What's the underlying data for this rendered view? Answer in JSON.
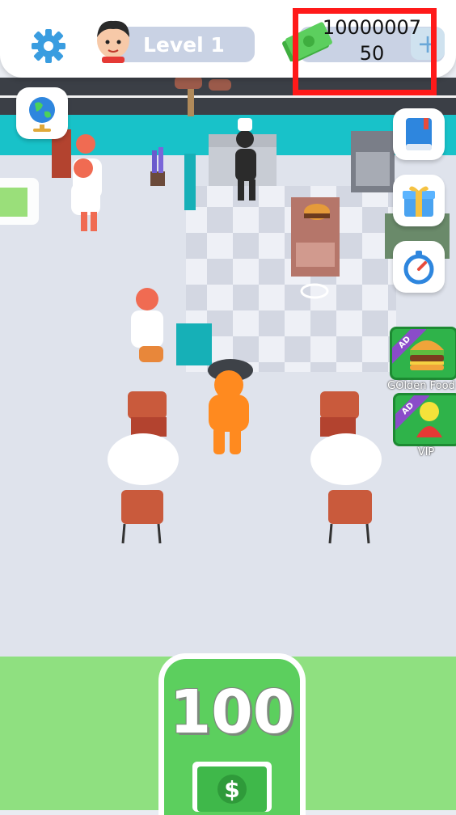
{
  "hud": {
    "level_label": "Level 1",
    "money_line1": "10000007",
    "money_line2": "50",
    "plus_symbol": "+"
  },
  "side_buttons": {
    "world": "globe-icon",
    "recipes": "book-icon",
    "gift": "gift-icon",
    "timer": "stopwatch-icon"
  },
  "ads": {
    "golden_food": {
      "badge": "AD",
      "caption": "GOlden Food"
    },
    "vip": {
      "badge": "AD",
      "caption": "VIP"
    }
  },
  "buy_zone": {
    "price": "100",
    "icon": "dollar-bill-icon"
  },
  "colors": {
    "highlight": "#ff1a1a",
    "accent_blue": "#3a9de0",
    "player": "#ff8a1f",
    "buy_green": "#5ccf5e"
  }
}
